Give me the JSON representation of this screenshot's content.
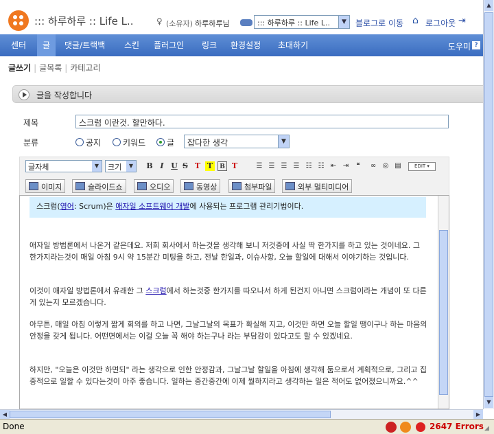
{
  "header": {
    "site_title": "::: 하루하루 :: Life L..",
    "owner_label": "(소유자)",
    "owner_name": "하루하루님",
    "blog_select_value": "::: 하루하루 :: Life L..",
    "go_blog": "블로그로 이동",
    "logout": "로그아웃"
  },
  "nav": {
    "items": [
      "센터",
      "글",
      "댓글/트랙백",
      "스킨",
      "플러그인",
      "링크",
      "환경설정",
      "초대하기"
    ],
    "helper": "도우미",
    "help_icon": "?"
  },
  "subnav": {
    "write": "글쓰기",
    "list": "글목록",
    "category": "카테고리"
  },
  "panel": {
    "title": "글을 작성합니다"
  },
  "form": {
    "title_label": "제목",
    "title_value": "스크럼 이란것. 할만하다.",
    "category_label": "분류",
    "radio_public": "공지",
    "radio_keyword": "키워드",
    "radio_post": "글",
    "category_value": "잡다한 생각"
  },
  "toolbar": {
    "font_face": "글자체",
    "font_size": "크기",
    "edit_label": "EDIT",
    "media": [
      "이미지",
      "슬라이드쇼",
      "오디오",
      "동영상",
      "첨부파일",
      "외부 멀티미디어"
    ]
  },
  "content": {
    "quote_pre": "스크럼(",
    "quote_link1": "영어",
    "quote_mid1": ": Scrum)은 ",
    "quote_link2": "애자일 소프트웨어 개발",
    "quote_post": "에 사용되는 프로그램 관리기법이다.",
    "p1": "애자일 방법론에서 나온거 같은데요. 저희 회사에서 하는것을 생각해 보니 저것중에 사실 딱 한가지를 하고 있는 것이네요. 그 한가지라는것이 매일 아침 9시 약 15분간 미팅을 하고, 전날 한일과, 이슈사항, 오늘 할일에 대해서 이야기하는 것입니다.",
    "p2_pre": "이것이 애자일 방법론에서 유래한 그 ",
    "p2_link": "스크럼",
    "p2_post": "에서 하는것중 한가지를 따오나서 하게 된건지 아니면 스크럼이라는 개념이 또 다른게 있는지 모르겠습니다.",
    "p3": "아무튼, 매일 아침 이렇게 짧게 회의를 하고 나면, 그날그날의 목표가 확실해 지고, 이것만 하면 오늘 할일 땡이구나 하는 마음의 안정을 갖게 됩니다. 어떤면에서는 이걸 오늘 꼭 해야 하는구나 라는 부담감이 있다고도 할 수 있겠네요.",
    "p4": "하지만, \"오늘은 이것만 하면되\" 라는 생각으로 인한 안정감과, 그날그날 할일을 아침에 생각해 둠으로서 계획적으로, 그리고 집중적으로 일할 수 있다는것이 아주 좋습니다. 일하는 중간중간에 이제 뭘하지라고 생각하는 일은 적어도 없어졌으니까요.^^"
  },
  "status": {
    "text": "Done",
    "errors": "2647 Errors"
  }
}
